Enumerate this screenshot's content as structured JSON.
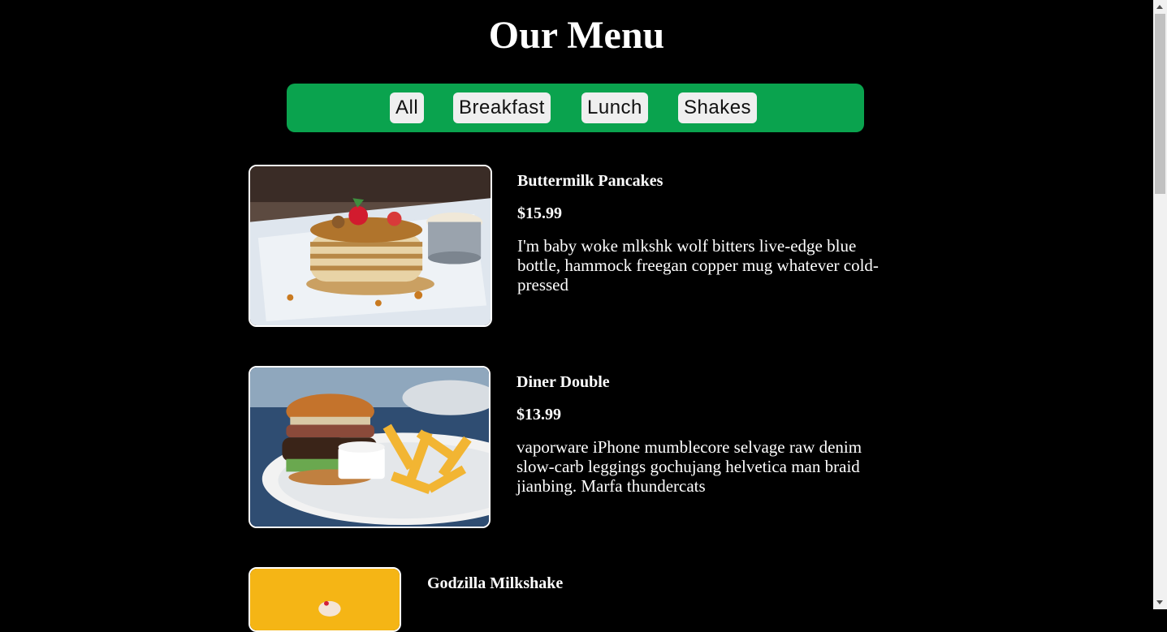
{
  "page": {
    "title": "Our Menu"
  },
  "filters": [
    "All",
    "Breakfast",
    "Lunch",
    "Shakes"
  ],
  "items": [
    {
      "title": "Buttermilk Pancakes",
      "price": "$15.99",
      "description": "I'm baby woke mlkshk wolf bitters live-edge blue bottle, hammock freegan copper mug whatever cold-pressed"
    },
    {
      "title": "Diner Double",
      "price": "$13.99",
      "description": "vaporware iPhone mumblecore selvage raw denim slow-carb leggings gochujang helvetica man braid jianbing. Marfa thundercats"
    },
    {
      "title": "Godzilla Milkshake"
    }
  ],
  "colors": {
    "background": "#000000",
    "filter_bar": "#0aa34e",
    "filter_button": "#efefef",
    "text": "#ffffff"
  },
  "icons": {
    "scroll_up": "arrow-up-icon",
    "scroll_down": "arrow-down-icon"
  }
}
